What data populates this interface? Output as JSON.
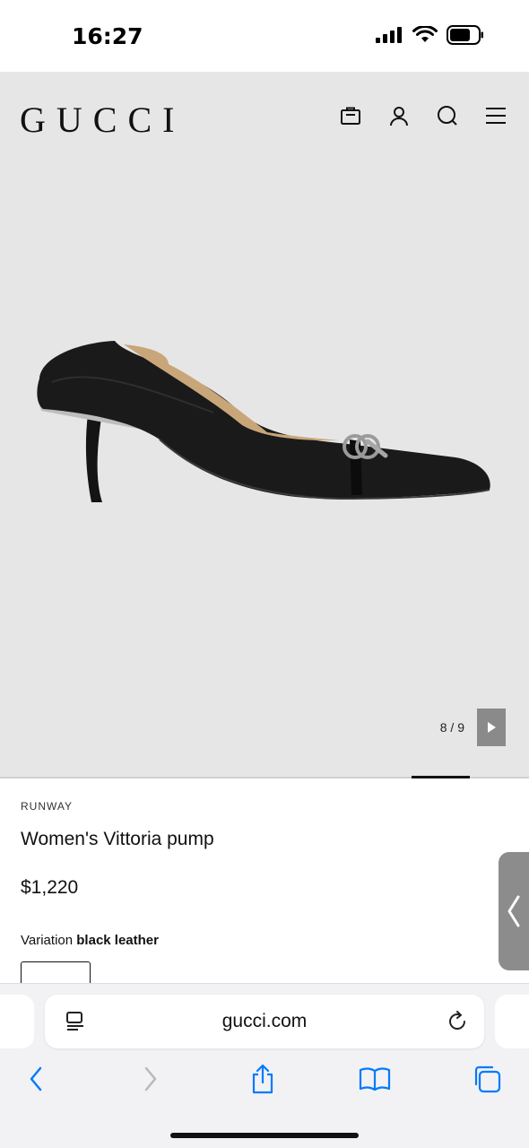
{
  "status": {
    "time": "16:27"
  },
  "header": {
    "logo": "GUCCI"
  },
  "gallery": {
    "counter": "8 / 9",
    "current": 8,
    "total": 9
  },
  "product": {
    "category": "RUNWAY",
    "name": "Women's Vittoria pump",
    "price": "$1,220",
    "variation_label": "Variation",
    "variation_value": "black leather"
  },
  "browser": {
    "url": "gucci.com"
  },
  "colors": {
    "accent": "#007aff",
    "hero_bg": "#e6e6e6",
    "text": "#111111"
  }
}
